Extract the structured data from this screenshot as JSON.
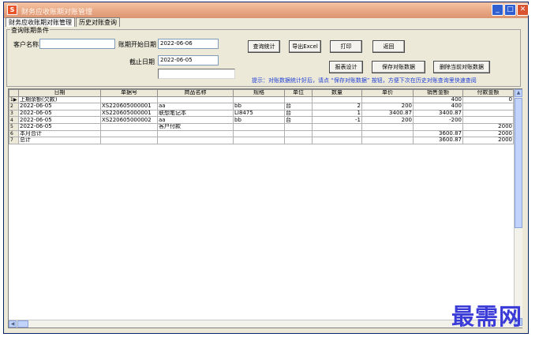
{
  "window": {
    "title": "财务应收账期对账管理",
    "app_icon_text": "S",
    "buttons": {
      "minimize": "_",
      "maximize": "□",
      "close": "✕"
    }
  },
  "tabs": [
    {
      "label": "财务应收账期对账管理",
      "active": true
    },
    {
      "label": "历史对账查询",
      "active": false
    }
  ],
  "query": {
    "group_title": "查询账期条件",
    "customer_label": "客户名称",
    "customer_value": "",
    "start_label": "账期开始日期",
    "start_value": "2022-06-06",
    "end_label": "截止日期",
    "end_value": "2022-06-05",
    "extra_value": ""
  },
  "toolbar": {
    "query_stats": "查询统计",
    "export_excel": "导出Excel",
    "print": "打印",
    "exit": "返回",
    "report_design": "报表设计",
    "save_data": "保存对账数据",
    "delete_data": "删除当前对账数据"
  },
  "tip": "提示：对账数据统计好后，请点 “保存对账数据” 按钮，方便下次在历史对账查询里快速查阅",
  "table": {
    "headers": [
      "日期",
      "单据号",
      "商品名称",
      "规格",
      "单位",
      "数量",
      "单价",
      "销售金额",
      "付款金额"
    ],
    "rows": [
      {
        "no": "1",
        "cells": [
          "上期余额(欠款)",
          "",
          "",
          "",
          "",
          "",
          "",
          "400",
          "0"
        ]
      },
      {
        "no": "2",
        "cells": [
          "2022-06-05",
          "XS220605000001",
          "aa",
          "bb",
          "台",
          "2",
          "200",
          "400",
          ""
        ]
      },
      {
        "no": "3",
        "cells": [
          "2022-06-05",
          "XS220605000001",
          "联想笔记本",
          "LI8475",
          "台",
          "1",
          "3400.87",
          "3400.87",
          ""
        ]
      },
      {
        "no": "4",
        "cells": [
          "2022-06-05",
          "XS220605000002",
          "aa",
          "bb",
          "台",
          "-1",
          "200",
          "-200",
          ""
        ]
      },
      {
        "no": "5",
        "cells": [
          "2022-06-05",
          "",
          "客户付款",
          "",
          "",
          "",
          "",
          "",
          "2000"
        ]
      },
      {
        "no": "6",
        "cells": [
          "本月合计",
          "",
          "",
          "",
          "",
          "",
          "",
          "3600.87",
          "2000"
        ]
      },
      {
        "no": "7",
        "cells": [
          "总计",
          "",
          "",
          "",
          "",
          "",
          "",
          "3600.87",
          "2000"
        ]
      }
    ]
  },
  "watermark": "最需网",
  "colors": {
    "titlebar": "#e8a783",
    "tip": "#1f3fd6",
    "watermark": "#3b3bd8"
  }
}
